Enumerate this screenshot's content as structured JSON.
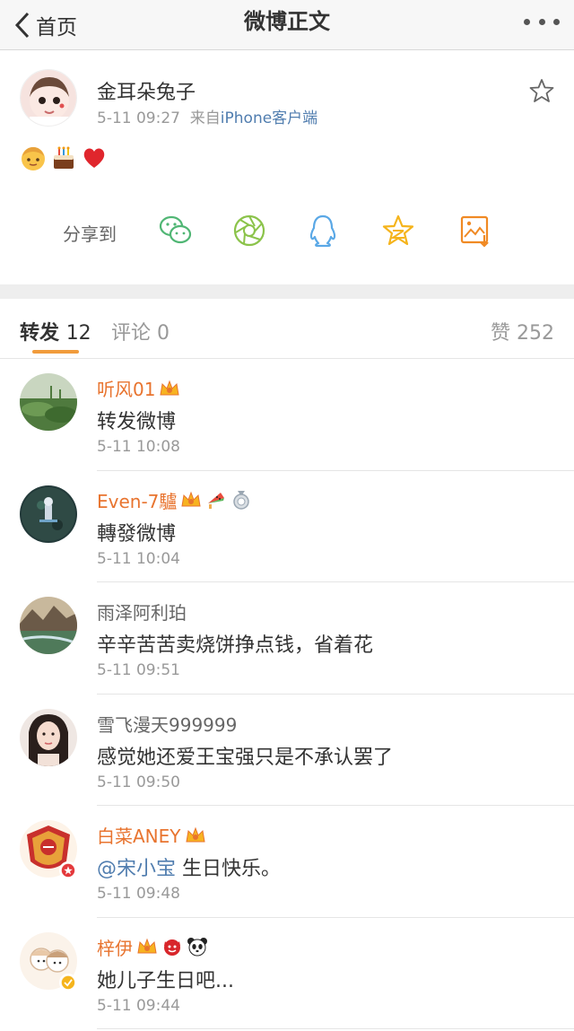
{
  "nav": {
    "back_label": "首页",
    "title": "微博正文"
  },
  "post": {
    "author": "金耳朵兔子",
    "time": "5-11 09:27",
    "source_prefix": "来自",
    "source": "iPhone客户端",
    "emojis": [
      "boy-emoji",
      "cake-emoji",
      "heart-emoji"
    ]
  },
  "share": {
    "label": "分享到",
    "targets": [
      "wechat-icon",
      "moments-icon",
      "qq-icon",
      "qzone-icon",
      "save-image-icon"
    ],
    "colors": {
      "wechat": "#50b674",
      "moments": "#8bc34a",
      "qq": "#5aa8e6",
      "qzone": "#f5b41c",
      "save": "#f08a24"
    }
  },
  "tabs": {
    "repost_label": "转发",
    "repost_count": "12",
    "comment_label": "评论",
    "comment_count": "0",
    "like_label": "赞",
    "like_count": "252",
    "accent": "#f19c3c"
  },
  "reposts": [
    {
      "name": "听风01",
      "text": "转发微博",
      "time": "5-11 10:08"
    },
    {
      "name": "Even-7驢",
      "text": "轉發微博",
      "time": "5-11 10:04"
    },
    {
      "name": "雨泽阿利珀",
      "text": "辛辛苦苦卖烧饼挣点钱，省着花",
      "time": "5-11 09:51"
    },
    {
      "name": "雪飞漫天999999",
      "text": "感觉她还爱王宝强只是不承认罢了",
      "time": "5-11 09:50"
    },
    {
      "name": "白菜ANEY",
      "mention": "@宋小宝",
      "text": "生日快乐。",
      "time": "5-11 09:48"
    },
    {
      "name": "梓伊",
      "text": "她儿子生日吧...",
      "time": "5-11 09:44"
    }
  ],
  "colors": {
    "vip_name": "#e8742f",
    "link": "#507daf",
    "muted": "#999999"
  }
}
